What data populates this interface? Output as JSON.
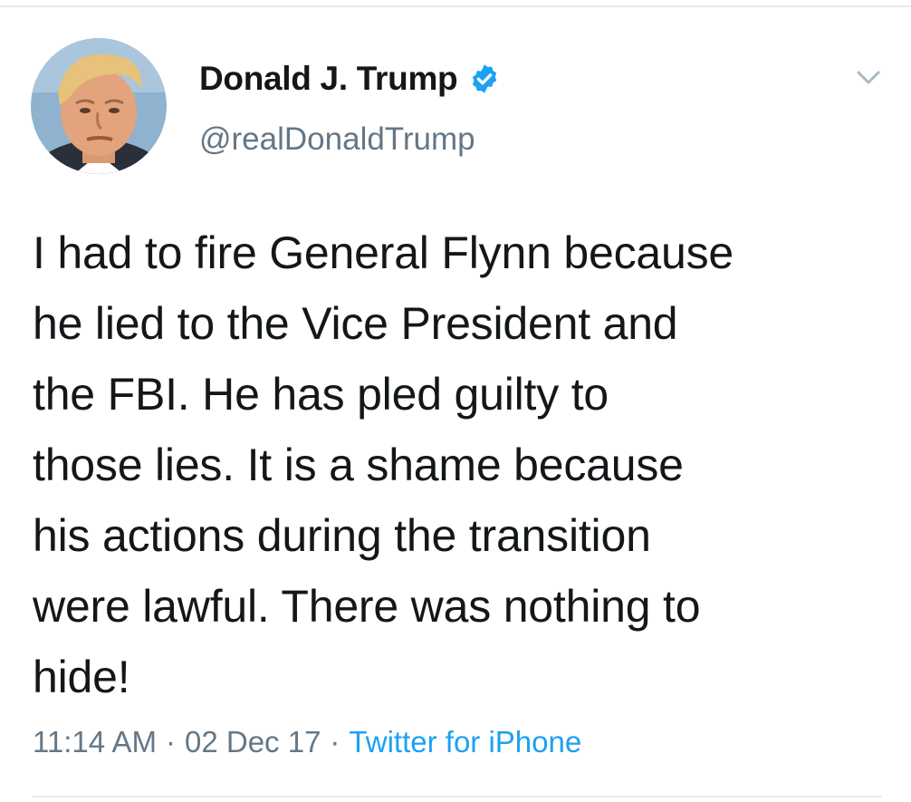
{
  "author": {
    "display_name": "Donald J. Trump",
    "handle": "@realDonaldTrump",
    "verified_icon": "verified-badge-icon",
    "avatar_icon": "profile-photo"
  },
  "tweet": {
    "text": "I had to fire General Flynn because\nhe lied to the Vice President and\nthe FBI. He has pled guilty to\nthose lies. It is a shame because\nhis actions during the transition\nwere lawful. There was nothing to\nhide!"
  },
  "meta": {
    "time": "11:14 AM",
    "separator": "·",
    "date": "02 Dec 17",
    "source": "Twitter for iPhone"
  },
  "menu": {
    "icon": "chevron-down-icon"
  },
  "colors": {
    "text": "#14171a",
    "secondary": "#657786",
    "link": "#1da1f2",
    "verified": "#1da1f2",
    "divider": "#e6ecf0"
  }
}
